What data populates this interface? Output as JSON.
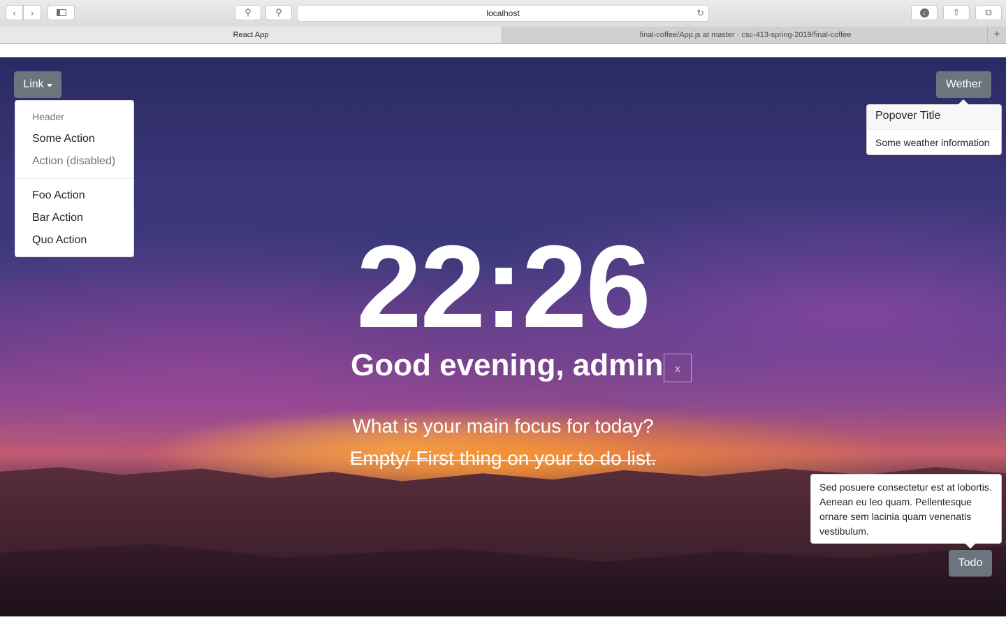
{
  "browser": {
    "url": "localhost",
    "tabs": [
      {
        "label": "React App",
        "active": true
      },
      {
        "label": "final-coffee/App.js at master · csc-413-spring-2019/final-coffee",
        "active": false
      }
    ]
  },
  "dropdown": {
    "toggle_label": "Link",
    "header": "Header",
    "items": [
      "Some Action",
      "Action (disabled)",
      "Foo Action",
      "Bar Action",
      "Quo Action"
    ]
  },
  "weather": {
    "button_label": "Wether",
    "popover_title": "Popover Title",
    "popover_body": "Some weather information"
  },
  "main": {
    "time": "22:26",
    "greeting": "Good evening, admin",
    "close_label": "x",
    "focus_question": "What is your main focus for today?",
    "focus_answer": "Empty/ First thing on your to do list."
  },
  "todo": {
    "button_label": "Todo",
    "popover_body": "Sed posuere consectetur est at lobortis. Aenean eu leo quam. Pellentesque ornare sem lacinia quam venenatis vestibulum."
  },
  "colors": {
    "secondary_button": "#6c757d",
    "disabled_text": "#6c757d"
  }
}
